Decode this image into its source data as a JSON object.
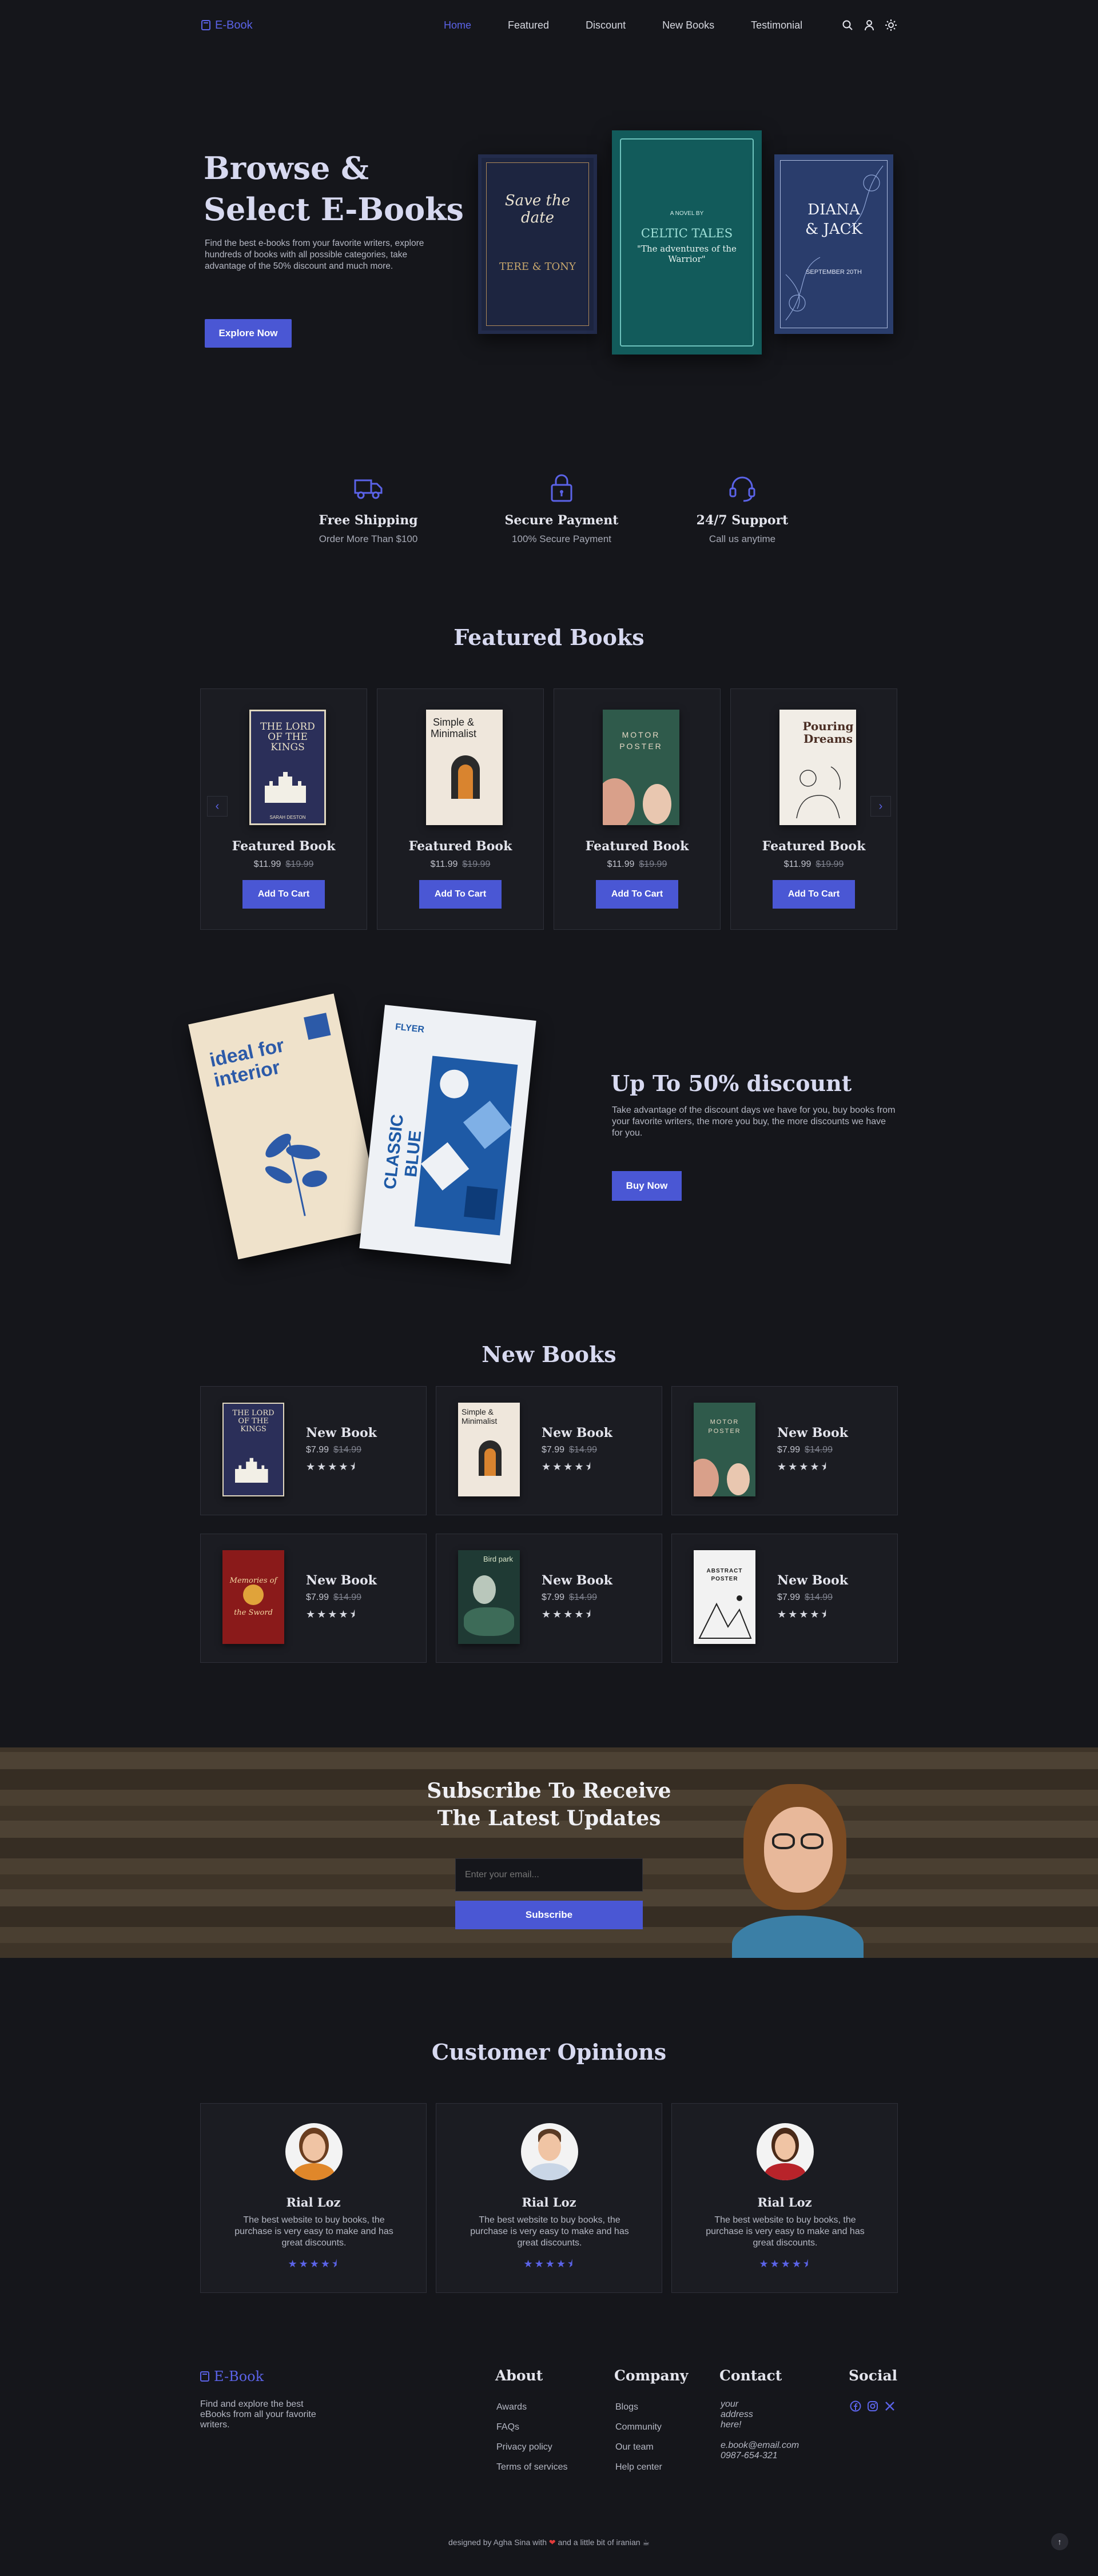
{
  "nav": {
    "logo": "E-Book",
    "links": [
      "Home",
      "Featured",
      "Discount",
      "New Books",
      "Testimonial"
    ]
  },
  "hero": {
    "title_line1": "Browse &",
    "title_line2": "Select E-Books",
    "description": "Find the best e-books from your favorite writers, explore hundreds of books with all possible categories, take advantage of the 50% discount and much more.",
    "button": "Explore Now",
    "covers": [
      {
        "text1": "Save the date",
        "text2": "TERE & TONY"
      },
      {
        "text1": "A NOVEL BY",
        "text2": "CELTIC TALES",
        "text3": "\"The adventures of the Warrior\""
      },
      {
        "text1": "DIANA & JACK",
        "text2": "SEPTEMBER 20TH"
      }
    ]
  },
  "features": [
    {
      "icon": "truck-icon",
      "title": "Free Shipping",
      "subtitle": "Order More Than $100"
    },
    {
      "icon": "lock-icon",
      "title": "Secure Payment",
      "subtitle": "100% Secure Payment"
    },
    {
      "icon": "headset-icon",
      "title": "24/7 Support",
      "subtitle": "Call us anytime"
    }
  ],
  "featured": {
    "title": "Featured Books",
    "items": [
      {
        "name": "Featured Book",
        "price": "$11.99",
        "old_price": "$19.99",
        "button": "Add To Cart",
        "cover_title": "THE LORD OF THE KINGS",
        "cover_author": "SARAH DESTON"
      },
      {
        "name": "Featured Book",
        "price": "$11.99",
        "old_price": "$19.99",
        "button": "Add To Cart",
        "cover_title": "Simple & Minimalist"
      },
      {
        "name": "Featured Book",
        "price": "$11.99",
        "old_price": "$19.99",
        "button": "Add To Cart",
        "cover_title": "MOTOR POSTER"
      },
      {
        "name": "Featured Book",
        "price": "$11.99",
        "old_price": "$19.99",
        "button": "Add To Cart",
        "cover_title": "Pouring Dreams"
      }
    ]
  },
  "discount": {
    "title": "Up To 50% discount",
    "description": "Take advantage of the discount days we have for you, buy books from your favorite writers, the more you buy, the more discounts we have for you.",
    "button": "Buy Now",
    "book1": {
      "title": "ideal for interior"
    },
    "book2": {
      "title1": "FLYER",
      "title2": "CLASSIC BLUE"
    }
  },
  "new_books": {
    "title": "New Books",
    "items": [
      {
        "name": "New Book",
        "price": "$7.99",
        "old_price": "$14.99",
        "stars": "★★★★⯨",
        "cover_title": "THE LORD OF THE KINGS"
      },
      {
        "name": "New Book",
        "price": "$7.99",
        "old_price": "$14.99",
        "stars": "★★★★⯨",
        "cover_title": "Simple & Minimalist"
      },
      {
        "name": "New Book",
        "price": "$7.99",
        "old_price": "$14.99",
        "stars": "★★★★⯨",
        "cover_title": "MOTOR POSTER"
      },
      {
        "name": "New Book",
        "price": "$7.99",
        "old_price": "$14.99",
        "stars": "★★★★⯨",
        "cover_title": "Memories of the Sword"
      },
      {
        "name": "New Book",
        "price": "$7.99",
        "old_price": "$14.99",
        "stars": "★★★★⯨",
        "cover_title": "Bird park"
      },
      {
        "name": "New Book",
        "price": "$7.99",
        "old_price": "$14.99",
        "stars": "★★★★⯨",
        "cover_title": "ABSTRACT POSTER"
      }
    ]
  },
  "subscribe": {
    "title_line1": "Subscribe To Receive",
    "title_line2": "The Latest Updates",
    "placeholder": "Enter your email...",
    "button": "Subscribe"
  },
  "opinions": {
    "title": "Customer Opinions",
    "items": [
      {
        "name": "Rial Loz",
        "text": "The best website to buy books, the purchase is very easy to make and has great discounts.",
        "stars": "★★★★⯨"
      },
      {
        "name": "Rial Loz",
        "text": "The best website to buy books, the purchase is very easy to make and has great discounts.",
        "stars": "★★★★⯨"
      },
      {
        "name": "Rial Loz",
        "text": "The best website to buy books, the purchase is very easy to make and has great discounts.",
        "stars": "★★★★⯨"
      }
    ]
  },
  "footer": {
    "logo": "E-Book",
    "tagline": "Find and explore the best eBooks from all your favorite writers.",
    "about": {
      "title": "About",
      "links": [
        "Awards",
        "FAQs",
        "Privacy policy",
        "Terms of services"
      ]
    },
    "company": {
      "title": "Company",
      "links": [
        "Blogs",
        "Community",
        "Our team",
        "Help center"
      ]
    },
    "contact": {
      "title": "Contact",
      "address": "your address here!",
      "email": "e.book@email.com",
      "phone": "0987-654-321"
    },
    "social": {
      "title": "Social",
      "icons": [
        "facebook-icon",
        "instagram-icon",
        "x-icon"
      ]
    },
    "credit_pre": "designed by Agha Sina with",
    "credit_post": "and a little bit of iranian",
    "accent": "#4a57d4"
  }
}
